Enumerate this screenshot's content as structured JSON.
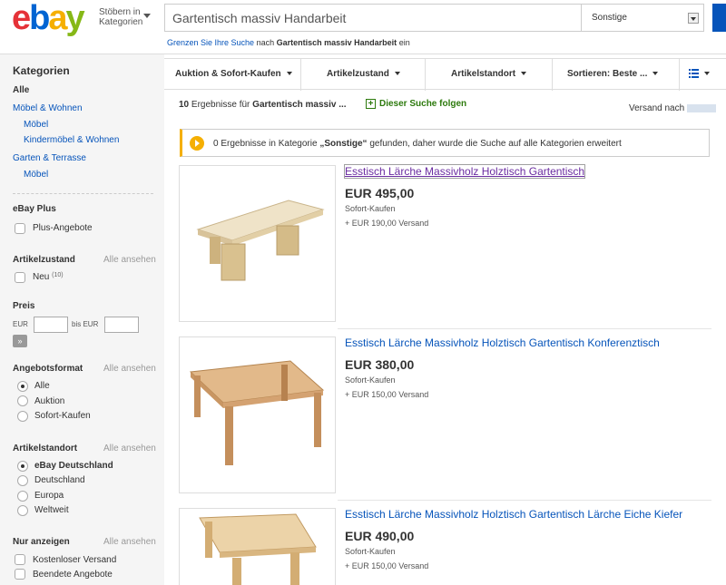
{
  "header": {
    "logo": {
      "e": "e",
      "b": "b",
      "a": "a",
      "y": "y"
    },
    "browse_line1": "Stöbern in",
    "browse_line2": "Kategorien",
    "search_value": "Gartentisch massiv Handarbeit",
    "category_select": "Sonstige",
    "hint_link": "Grenzen Sie Ihre Suche",
    "hint_mid": "nach",
    "hint_query": "Gartentisch massiv Handarbeit",
    "hint_end": "ein"
  },
  "sidebar": {
    "kategorien_title": "Kategorien",
    "alle": "Alle",
    "categories": [
      {
        "label": "Möbel & Wohnen"
      },
      {
        "label": "Möbel"
      },
      {
        "label": "Kindermöbel & Wohnen"
      },
      {
        "label": "Garten & Terrasse"
      },
      {
        "label": "Möbel"
      }
    ],
    "ebay_plus": {
      "title": "eBay Plus",
      "option": "Plus-Angebote"
    },
    "zustand": {
      "title": "Artikelzustand",
      "all": "Alle ansehen",
      "option": "Neu",
      "count": "(10)"
    },
    "preis": {
      "title": "Preis",
      "from": "EUR",
      "to_prefix": "bis EUR",
      "go": "»"
    },
    "format": {
      "title": "Angebotsformat",
      "all": "Alle ansehen",
      "options": [
        "Alle",
        "Auktion",
        "Sofort-Kaufen"
      ]
    },
    "standort": {
      "title": "Artikelstandort",
      "all": "Alle ansehen",
      "options": [
        "eBay Deutschland",
        "Deutschland",
        "Europa",
        "Weltweit"
      ]
    },
    "nur": {
      "title": "Nur anzeigen",
      "all": "Alle ansehen",
      "options": [
        "Kostenloser Versand",
        "Beendete Angebote"
      ]
    }
  },
  "filterbar": {
    "items": [
      "Auktion & Sofort-Kaufen",
      "Artikelzustand",
      "Artikelstandort",
      "Sortieren: Beste ..."
    ]
  },
  "results": {
    "count": "10",
    "count_text": "Ergebnisse für",
    "query": "Gartentisch massiv ...",
    "follow": "Dieser Suche folgen",
    "ship_to": "Versand nach",
    "notice_pre": "0 Ergebnisse in Kategorie",
    "notice_cat": "„Sonstige“",
    "notice_post": "gefunden, daher wurde die Suche auf alle Kategorien erweitert"
  },
  "listings": [
    {
      "title": "Esstisch Lärche Massivholz Holztisch Gartentisch",
      "price": "EUR 495,00",
      "format": "Sofort-Kaufen",
      "shipping": "+ EUR 190,00 Versand"
    },
    {
      "title": "Esstisch Lärche Massivholz Holztisch Gartentisch Konferenztisch",
      "price": "EUR 380,00",
      "format": "Sofort-Kaufen",
      "shipping": "+ EUR 150,00 Versand"
    },
    {
      "title": "Esstisch Lärche Massivholz Holztisch Gartentisch Lärche Eiche Kiefer",
      "price": "EUR 490,00",
      "format": "Sofort-Kaufen",
      "shipping": "+ EUR 150,00 Versand"
    }
  ],
  "colors": {
    "link": "#0654ba",
    "visited": "#6a2ca0",
    "accent": "#f5af02",
    "follow": "#2d7a0d"
  }
}
